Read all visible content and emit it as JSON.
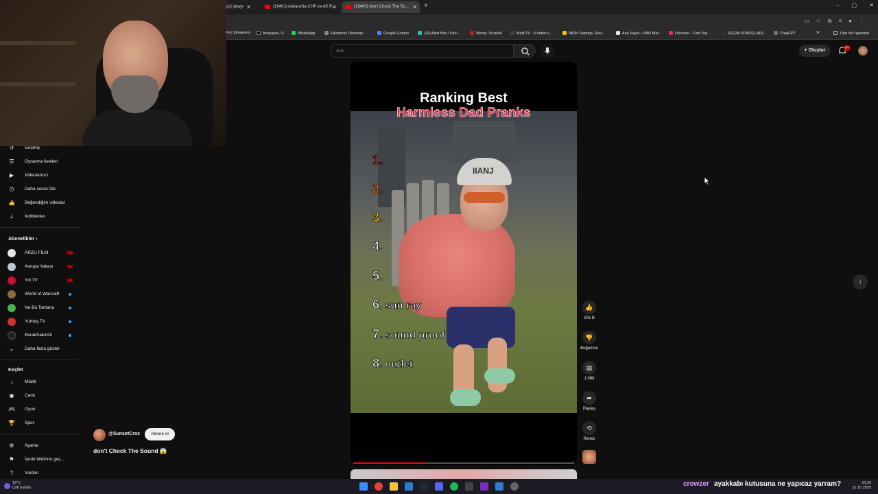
{
  "browser": {
    "tabs": [
      {
        "label": "pçi şikayı",
        "active": false
      },
      {
        "label": "(16401) Ankara'da CHP ve AK P...",
        "active": false
      },
      {
        "label": "(16400) don't Check The So...",
        "active": true
      }
    ],
    "new_tab": "+",
    "window_controls": [
      "–",
      "▢",
      "✕"
    ],
    "bookmarks": [
      {
        "label": "For Streamers",
        "color": "#555"
      },
      {
        "label": "Anasayfa / X",
        "color": "#000"
      },
      {
        "label": "WhatsApp",
        "color": "#25d366"
      },
      {
        "label": "Electronic Diversity...",
        "color": "#888"
      },
      {
        "label": "Google Gemini",
        "color": "#4f86f7"
      },
      {
        "label": "(19) Alert Box / Stre...",
        "color": "#31c3a2"
      },
      {
        "label": "Windy: Sıcaklık",
        "color": "#b3261e"
      },
      {
        "label": "Multi TV - 6 haber k...",
        "color": "#444"
      },
      {
        "label": "IMDb: Ratings, Revi...",
        "color": "#f5c518"
      },
      {
        "label": "Ana Sayfa • HBO Max",
        "color": "#eee"
      },
      {
        "label": "Discover - Find Top...",
        "color": "#e1306c"
      },
      {
        "label": "SEÇİM SONUÇLARI...",
        "color": "#333"
      },
      {
        "label": "ChatGPT",
        "color": "#777"
      }
    ],
    "bookmarks_more": "»",
    "all_bookmarks": "Tüm Yer İşaretleri"
  },
  "youtube": {
    "search_placeholder": "Ara",
    "create_label": "Oluştur",
    "notification_badge": "9+"
  },
  "sidebar": {
    "you_items": [
      {
        "label": "Geçmiş",
        "icon": "history-icon",
        "glyph": "↺"
      },
      {
        "label": "Oynatma listeleri",
        "icon": "playlist-icon",
        "glyph": "☰"
      },
      {
        "label": "Videolarınız",
        "icon": "your-videos-icon",
        "glyph": "▶"
      },
      {
        "label": "Daha sonra izle",
        "icon": "watch-later-icon",
        "glyph": "◷"
      },
      {
        "label": "Beğendiğim videolar",
        "icon": "liked-icon",
        "glyph": "👍"
      },
      {
        "label": "İndirilenler",
        "icon": "download-icon",
        "glyph": "⤓"
      }
    ],
    "subscriptions_title": "Abonelikler",
    "subscriptions": [
      {
        "label": "ARZU FİLM",
        "color": "#e6e6e6",
        "status": "live"
      },
      {
        "label": "Avrupa Yakası",
        "color": "#b9c8d6",
        "status": "live"
      },
      {
        "label": "Yol TV",
        "color": "#c8102e",
        "status": "live"
      },
      {
        "label": "World of Warcraft",
        "color": "#8a6d3b",
        "status": "dot"
      },
      {
        "label": "Ne Bu Tantana",
        "color": "#4caf50",
        "status": "dot"
      },
      {
        "label": "Yurttaş TV",
        "color": "#d32f2f",
        "status": "dot"
      },
      {
        "label": "BurakSakinOl",
        "color": "#222222",
        "status": "dot"
      }
    ],
    "show_more": "Daha fazla göster",
    "explore_title": "Keşfet",
    "explore_items": [
      {
        "label": "Müzik",
        "icon": "music-icon",
        "glyph": "♪"
      },
      {
        "label": "Canlı",
        "icon": "live-icon",
        "glyph": "◉"
      },
      {
        "label": "Oyun",
        "icon": "gaming-icon",
        "glyph": "🎮"
      },
      {
        "label": "Spor",
        "icon": "trophy-icon",
        "glyph": "🏆"
      }
    ],
    "settings_items": [
      {
        "label": "Ayarlar",
        "icon": "settings-icon",
        "glyph": "⚙"
      },
      {
        "label": "İçerik bildirme geç...",
        "icon": "flag-icon",
        "glyph": "⚑"
      },
      {
        "label": "Yardım",
        "icon": "help-icon",
        "glyph": "?"
      }
    ]
  },
  "short": {
    "title_line1": "Ranking Best",
    "title_line2": "Harmless Dad Pranks",
    "cap_text": "IIANJ",
    "ranks": [
      {
        "n": "1.",
        "text": ""
      },
      {
        "n": "2.",
        "text": ""
      },
      {
        "n": "3.",
        "text": ""
      },
      {
        "n": "4.",
        "text": ""
      },
      {
        "n": "5.",
        "text": ""
      },
      {
        "n": "6.",
        "text": "sun ray"
      },
      {
        "n": "7.",
        "text": "sound proof"
      },
      {
        "n": "8.",
        "text": "outlet"
      }
    ],
    "rank_colors": [
      "#e2233f",
      "#ff7a1a",
      "#ffd400",
      "#ffffff",
      "#ffffff",
      "#ffffff",
      "#ffffff",
      "#ffffff"
    ],
    "progress": 0.33,
    "channel": "@SunsetCroc",
    "subscribe": "Abone ol",
    "video_title": "don't Check The Sound 😱"
  },
  "actions": {
    "like_count": "205 B",
    "dislike_label": "Beğenme",
    "comment_count": "1.088",
    "share_label": "Paylaş",
    "remix_label": "Remix"
  },
  "taskbar": {
    "temp": "12°C",
    "weather": "Çok bulutlu",
    "time": "23:39",
    "date": "31.10.2025"
  },
  "chat": {
    "user": "crowzer",
    "message": "ayakkabı kutusuna ne yapıcaz yarram?"
  }
}
